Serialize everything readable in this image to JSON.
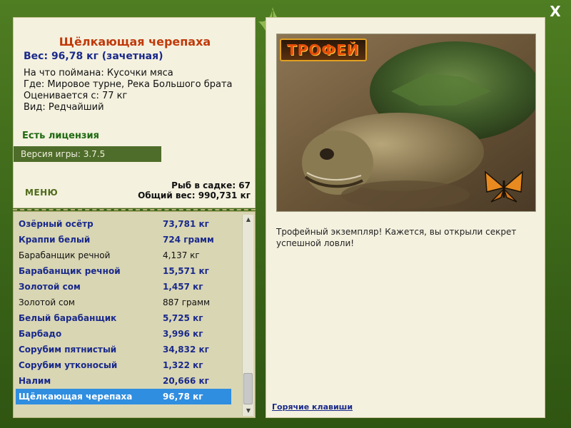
{
  "window": {
    "close_glyph": "X"
  },
  "fish": {
    "title": "Щёлкающая черепаха",
    "weight": "Вес: 96,78 кг (зачетная)",
    "bait": "На что поймана: Кусочки мяса",
    "where": "Где: Мировое турне, Река Большого брата",
    "score_from": "Оценивается с: 77 кг",
    "kind": "Вид: Редчайший"
  },
  "license": "Есть лицензия",
  "version": "Версия игры: 3.7.5",
  "menu_label": "МЕНЮ",
  "stats": {
    "fish_in_keepnet": "Рыб в садке: 67",
    "total_weight": "Общий вес: 990,731 кг"
  },
  "catch_list": [
    {
      "name": "Озёрный осётр",
      "weight": "73,781 кг",
      "bold": true
    },
    {
      "name": "Краппи белый",
      "weight": "724 грамм",
      "bold": true
    },
    {
      "name": "Барабанщик речной",
      "weight": "4,137 кг",
      "bold": false
    },
    {
      "name": "Барабанщик речной",
      "weight": "15,571 кг",
      "bold": true
    },
    {
      "name": "Золотой сом",
      "weight": "1,457 кг",
      "bold": true
    },
    {
      "name": "Золотой сом",
      "weight": "887 грамм",
      "bold": false
    },
    {
      "name": "Белый барабанщик",
      "weight": "5,725 кг",
      "bold": true
    },
    {
      "name": "Барбадо",
      "weight": "3,996 кг",
      "bold": true
    },
    {
      "name": "Сорубим пятнистый",
      "weight": "34,832 кг",
      "bold": true
    },
    {
      "name": "Сорубим утконосый",
      "weight": "1,322 кг",
      "bold": true
    },
    {
      "name": "Налим",
      "weight": "20,666 кг",
      "bold": true
    },
    {
      "name": "Щёлкающая черепаха",
      "weight": "96,78 кг",
      "bold": true,
      "selected": true
    }
  ],
  "photo": {
    "badge": "ТРОФЕЙ"
  },
  "description": "Трофейный экземпляр! Кажется, вы открыли секрет успешной ловли!",
  "hotkeys_link": "Горячие клавиши",
  "icons": [
    "close-icon",
    "leaf-ornament-icon",
    "scroll-up-icon",
    "scroll-down-icon"
  ]
}
